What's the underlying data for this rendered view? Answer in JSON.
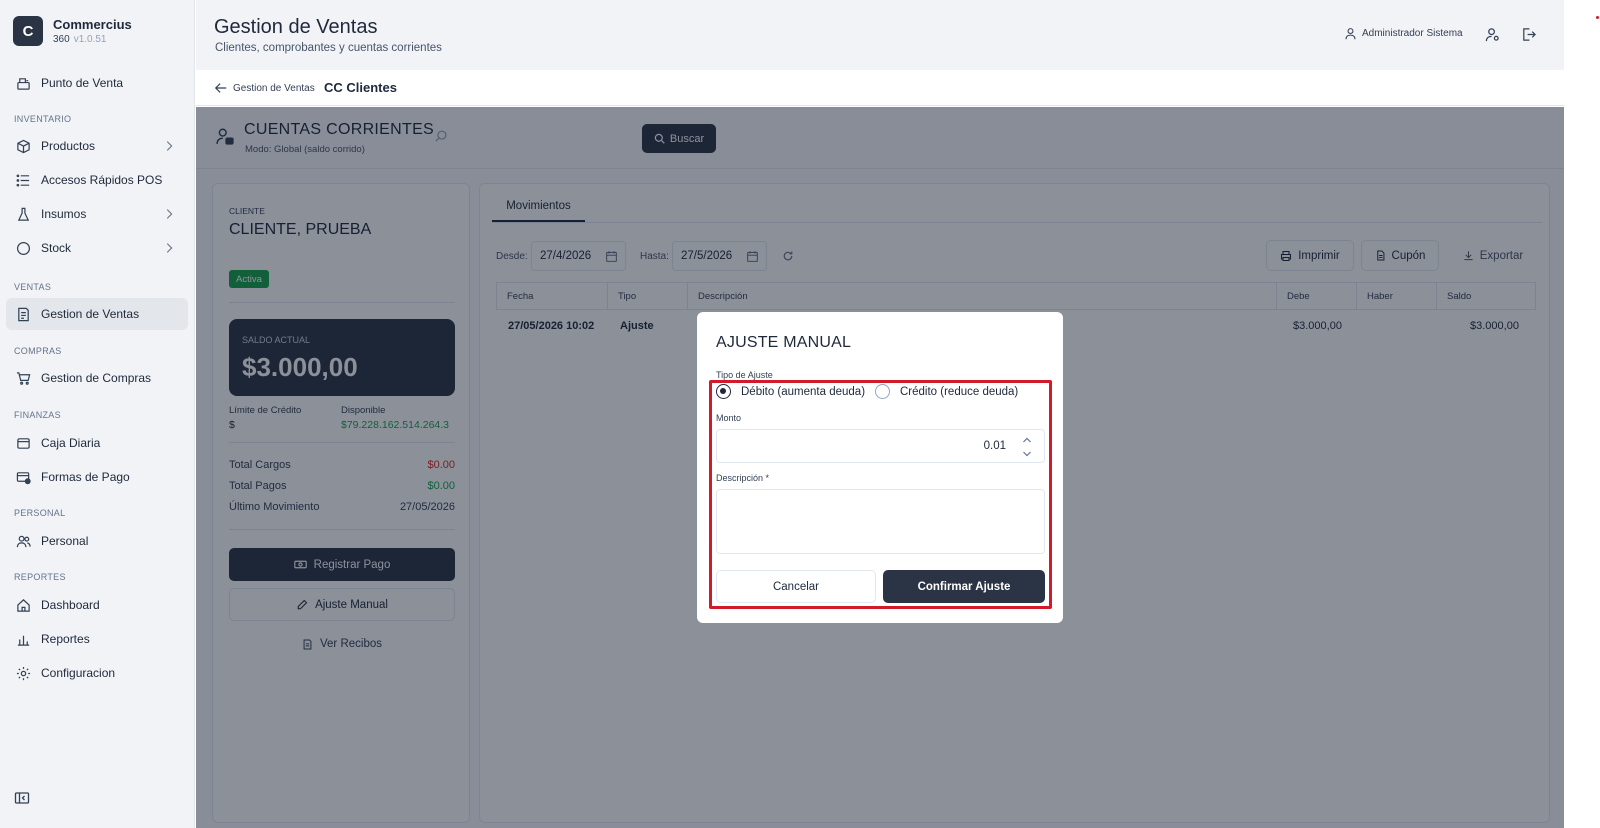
{
  "brand": {
    "letter": "C",
    "name": "Commercius",
    "product": "360",
    "version": "v1.0.51"
  },
  "sidebar": {
    "items": [
      {
        "label": "Punto de Venta"
      },
      {
        "section": "INVENTARIO"
      },
      {
        "label": "Productos"
      },
      {
        "label": "Accesos Rápidos POS"
      },
      {
        "label": "Insumos"
      },
      {
        "label": "Stock"
      },
      {
        "section": "VENTAS"
      },
      {
        "label": "Gestion de Ventas"
      },
      {
        "section": "COMPRAS"
      },
      {
        "label": "Gestion de Compras"
      },
      {
        "section": "FINANZAS"
      },
      {
        "label": "Caja Diaria"
      },
      {
        "label": "Formas de Pago"
      },
      {
        "section": "PERSONAL"
      },
      {
        "label": "Personal"
      },
      {
        "section": "REPORTES"
      },
      {
        "label": "Dashboard"
      },
      {
        "label": "Reportes"
      },
      {
        "label": "Configuracion"
      }
    ]
  },
  "header": {
    "title": "Gestion de Ventas",
    "subtitle": "Clientes, comprobantes y cuentas corrientes",
    "user": "Administrador Sistema"
  },
  "breadcrumb": {
    "back": "Gestion de Ventas",
    "current": "CC Clientes"
  },
  "cc": {
    "title": "CUENTAS CORRIENTES",
    "mode": "Modo: Global (saldo corrido)",
    "search_placeholder": "",
    "search_button": "Buscar"
  },
  "client": {
    "label": "CLIENTE",
    "name": "CLIENTE, PRUEBA",
    "status": "Activa",
    "balance_label": "SALDO ACTUAL",
    "balance": "$3.000,00",
    "credit_limit_label": "Límite de Crédito",
    "credit_limit": "$",
    "available_label": "Disponible",
    "available": "$79.228.162.514.264.3",
    "total_charges_label": "Total Cargos",
    "total_charges": "$0.00",
    "total_payments_label": "Total Pagos",
    "total_payments": "$0.00",
    "last_movement_label": "Último Movimiento",
    "last_movement": "27/05/2026",
    "register_payment": "Registrar Pago",
    "manual_adjust": "Ajuste Manual",
    "view_receipts": "Ver Recibos"
  },
  "movements": {
    "tab": "Movimientos",
    "from_label": "Desde:",
    "from": "27/4/2026",
    "to_label": "Hasta:",
    "to": "27/5/2026",
    "print": "Imprimir",
    "coupon": "Cupón",
    "export": "Exportar",
    "columns": [
      "Fecha",
      "Tipo",
      "Descripción",
      "Debe",
      "Haber",
      "Saldo"
    ],
    "rows": [
      {
        "fecha": "27/05/2026 10:02",
        "tipo": "Ajuste",
        "descripcion": "",
        "debe": "$3.000,00",
        "haber": "",
        "saldo": "$3.000,00"
      }
    ]
  },
  "modal": {
    "title": "AJUSTE MANUAL",
    "type_label": "Tipo de Ajuste",
    "debit": "Débito (aumenta deuda)",
    "credit": "Crédito (reduce deuda)",
    "selected": "debit",
    "amount_label": "Monto",
    "amount": "0.01",
    "description_label": "Descripción *",
    "description": "",
    "cancel": "Cancelar",
    "confirm": "Confirmar Ajuste"
  },
  "colors": {
    "primary": "#2a3444",
    "success": "#16a34a",
    "danger": "#dc2626",
    "highlight": "#d11a2a"
  }
}
